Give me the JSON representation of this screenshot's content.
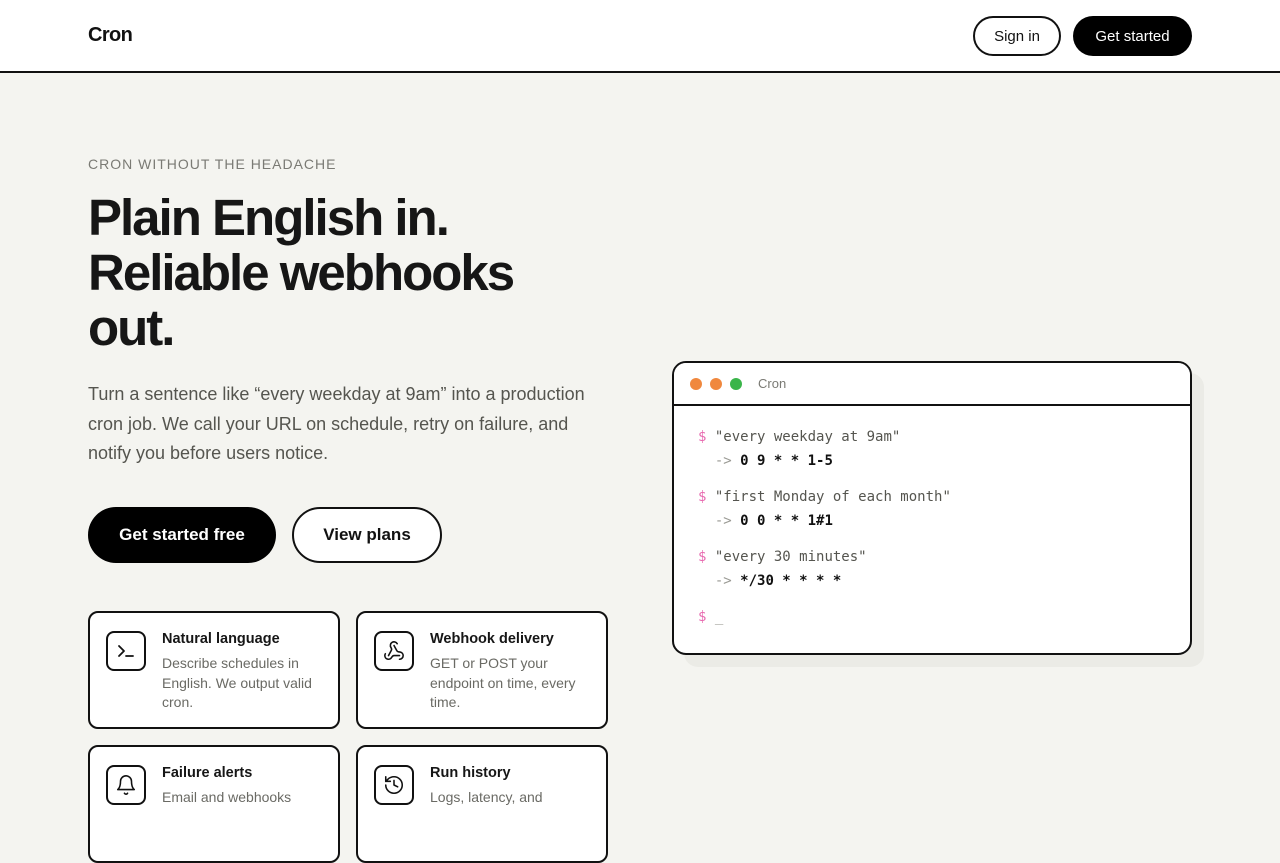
{
  "header": {
    "logo": "Cron",
    "sign_in": "Sign in",
    "get_started": "Get started"
  },
  "hero": {
    "eyebrow": "CRON WITHOUT THE HEADACHE",
    "headline_lines": [
      "Plain English in.",
      "Reliable webhooks",
      "out."
    ],
    "subtext": "Turn a sentence like “every weekday at 9am” into a production cron job. We call your URL on schedule, retry on failure, and notify you before users notice.",
    "primary_cta": "Get started free",
    "secondary_cta": "View plans"
  },
  "features": [
    {
      "icon": "terminal-icon",
      "title": "Natural language",
      "description": "Describe schedules in English. We output valid cron."
    },
    {
      "icon": "webhook-icon",
      "title": "Webhook delivery",
      "description": "GET or POST your endpoint on time, every time."
    },
    {
      "icon": "bell-icon",
      "title": "Failure alerts",
      "description": "Email and webhooks"
    },
    {
      "icon": "history-icon",
      "title": "Run history",
      "description": "Logs, latency, and"
    }
  ],
  "terminal": {
    "title": "Cron",
    "prompt": "$",
    "arrow": "->",
    "examples": [
      {
        "input": "\"every weekday at 9am\"",
        "output": "0 9 * * 1-5"
      },
      {
        "input": "\"first Monday of each month\"",
        "output": "0 0 * * 1#1"
      },
      {
        "input": "\"every 30 minutes\"",
        "output": "*/30 * * * *"
      }
    ],
    "cursor": "_"
  },
  "colors": {
    "background": "#f4f4f0",
    "accent": "#000000",
    "prompt": "#e86bb0",
    "dot_orange": "#f0883e",
    "dot_green": "#3ab54a"
  }
}
